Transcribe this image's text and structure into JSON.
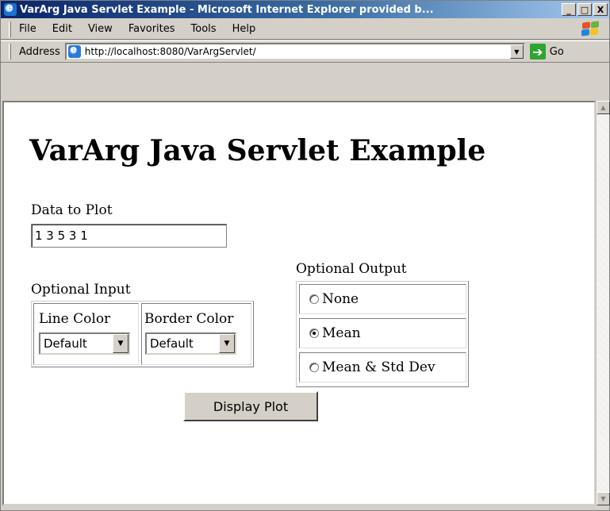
{
  "window": {
    "title": "VarArg Java Servlet Example - Microsoft Internet Explorer provided b...",
    "controls": [
      "_",
      "□",
      "X"
    ]
  },
  "menu": [
    {
      "label": "File"
    },
    {
      "label": "Edit"
    },
    {
      "label": "View"
    },
    {
      "label": "Favorites"
    },
    {
      "label": "Tools"
    },
    {
      "label": "Help"
    }
  ],
  "address": {
    "label": "Address",
    "url": "http://localhost:8080/VarArgServlet/",
    "go_label": "Go"
  },
  "page": {
    "heading": "VarArg Java Servlet Example",
    "data_label": "Data to Plot",
    "data_value": "1 3 5 3 1",
    "optional_input": {
      "label": "Optional Input",
      "line_color_label": "Line Color",
      "line_color_value": "Default",
      "border_color_label": "Border Color",
      "border_color_value": "Default"
    },
    "optional_output": {
      "label": "Optional Output",
      "options": [
        {
          "label": "None",
          "checked": false
        },
        {
          "label": "Mean",
          "checked": true
        },
        {
          "label": "Mean & Std Dev",
          "checked": false
        }
      ]
    },
    "submit_label": "Display Plot"
  }
}
